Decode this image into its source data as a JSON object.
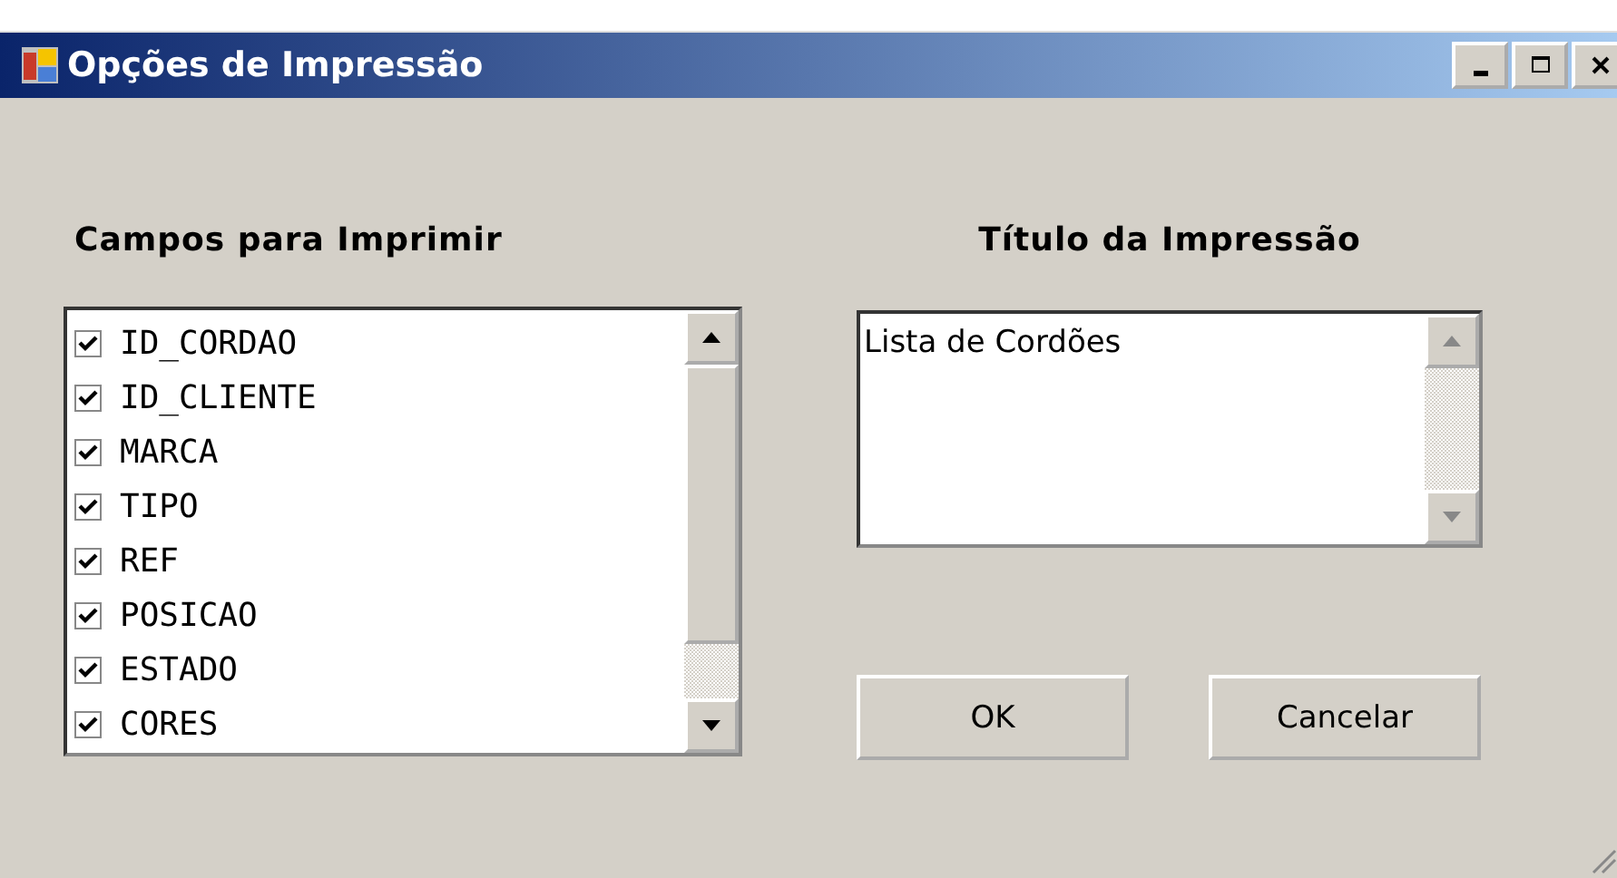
{
  "window": {
    "title": "Opções de Impressão",
    "controls": [
      {
        "kind": "minimize"
      },
      {
        "kind": "maximize"
      },
      {
        "kind": "close"
      }
    ]
  },
  "fields_label": "Campos para Imprimir",
  "fields": [
    {
      "label": "ID_CORDAO",
      "checked": true
    },
    {
      "label": "ID_CLIENTE",
      "checked": true
    },
    {
      "label": "MARCA",
      "checked": true
    },
    {
      "label": "TIPO",
      "checked": true
    },
    {
      "label": "REF",
      "checked": true
    },
    {
      "label": "POSICAO",
      "checked": true
    },
    {
      "label": "ESTADO",
      "checked": true
    },
    {
      "label": "CORES",
      "checked": true
    }
  ],
  "title_label": "Título da Impressão",
  "title_field": {
    "value": "Lista de Cordões"
  },
  "buttons": [
    "OK",
    "Cancelar"
  ]
}
